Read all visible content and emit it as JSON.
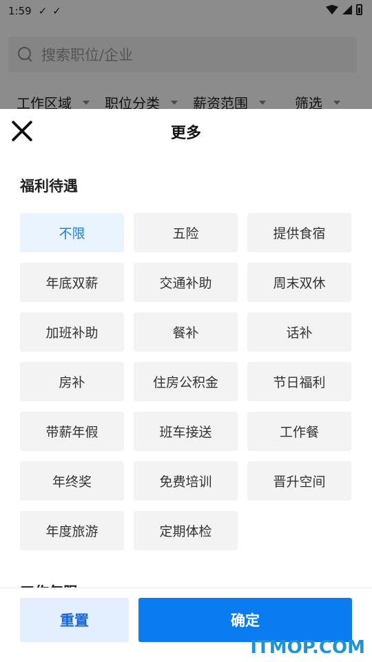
{
  "status_bar": {
    "time": "1:59",
    "notif_icons": [
      "download-done-icon",
      "download-done-icon"
    ],
    "right_icons": [
      "wifi-icon",
      "cell-signal-icon",
      "battery-icon"
    ]
  },
  "search": {
    "placeholder": "搜索职位/企业"
  },
  "filters": [
    {
      "label": "工作区域"
    },
    {
      "label": "职位分类"
    },
    {
      "label": "薪资范围"
    },
    {
      "label": "筛选"
    }
  ],
  "sheet": {
    "title": "更多",
    "section_title": "福利待遇",
    "tags": [
      {
        "label": "不限",
        "selected": true
      },
      {
        "label": "五险"
      },
      {
        "label": "提供食宿"
      },
      {
        "label": "年底双薪"
      },
      {
        "label": "交通补助"
      },
      {
        "label": "周末双休"
      },
      {
        "label": "加班补助"
      },
      {
        "label": "餐补"
      },
      {
        "label": "话补"
      },
      {
        "label": "房补"
      },
      {
        "label": "住房公积金"
      },
      {
        "label": "节日福利"
      },
      {
        "label": "带薪年假"
      },
      {
        "label": "班车接送"
      },
      {
        "label": "工作餐"
      },
      {
        "label": "年终奖"
      },
      {
        "label": "免费培训"
      },
      {
        "label": "晋升空间"
      },
      {
        "label": "年度旅游"
      },
      {
        "label": "定期体检"
      }
    ],
    "next_section_title": "工作年限",
    "reset_label": "重置",
    "confirm_label": "确定"
  },
  "colors": {
    "accent": "#0a7cf0",
    "selected_text": "#1a7ee6",
    "selected_bg": "#eaf4ff",
    "reset_bg": "#e3efff"
  },
  "watermark": "ITMOP.COM"
}
